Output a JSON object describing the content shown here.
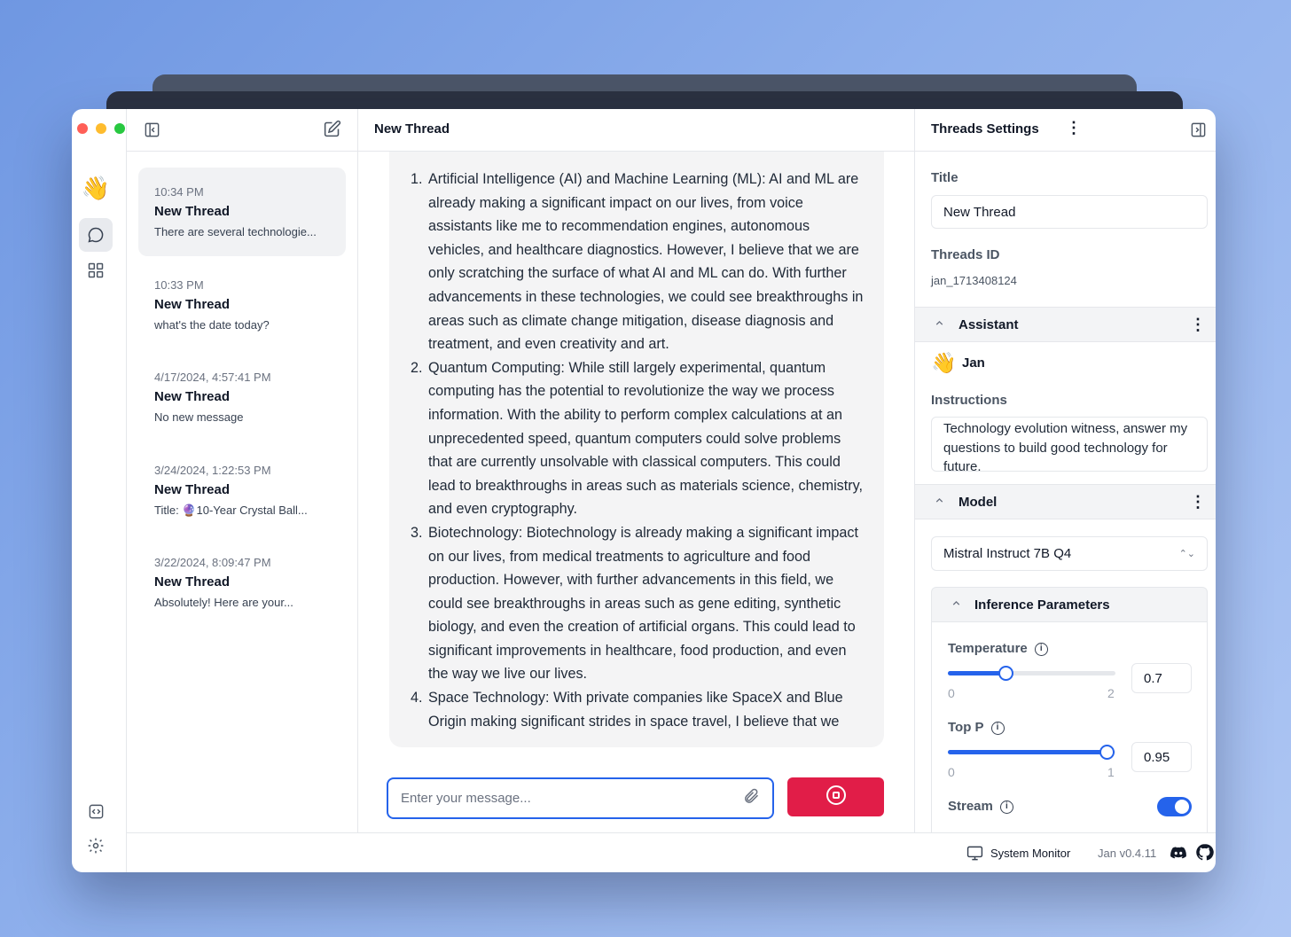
{
  "colors": {
    "accent": "#2563eb",
    "stop": "#e11d48"
  },
  "header": {
    "title": "New Thread"
  },
  "threads": [
    {
      "time": "10:34 PM",
      "title": "New Thread",
      "snippet": "There are several technologie..."
    },
    {
      "time": "10:33 PM",
      "title": "New Thread",
      "snippet": "what's the date today?"
    },
    {
      "time": "4/17/2024, 4:57:41 PM",
      "title": "New Thread",
      "snippet": "No new message"
    },
    {
      "time": "3/24/2024, 1:22:53 PM",
      "title": "New Thread",
      "snippet": "Title: 🔮10-Year Crystal Ball..."
    },
    {
      "time": "3/22/2024, 8:09:47 PM",
      "title": "New Thread",
      "snippet": "Absolutely! Here are your..."
    }
  ],
  "message": {
    "items": [
      {
        "num": "1.",
        "text": "Artificial Intelligence (AI) and Machine Learning (ML): AI and ML are already making a significant impact on our lives, from voice assistants like me to recommendation engines, autonomous vehicles, and healthcare diagnostics. However, I believe that we are only scratching the surface of what AI and ML can do. With further advancements in these technologies, we could see breakthroughs in areas such as climate change mitigation, disease diagnosis and treatment, and even creativity and art."
      },
      {
        "num": "2.",
        "text": "Quantum Computing: While still largely experimental, quantum computing has the potential to revolutionize the way we process information. With the ability to perform complex calculations at an unprecedented speed, quantum computers could solve problems that are currently unsolvable with classical computers. This could lead to breakthroughs in areas such as materials science, chemistry, and even cryptography."
      },
      {
        "num": "3.",
        "text": "Biotechnology: Biotechnology is already making a significant impact on our lives, from medical treatments to agriculture and food production. However, with further advancements in this field, we could see breakthroughs in areas such as gene editing, synthetic biology, and even the creation of artificial organs. This could lead to significant improvements in healthcare, food production, and even the way we live our lives."
      },
      {
        "num": "4.",
        "text": "Space Technology: With private companies like SpaceX and Blue Origin making significant strides in space travel, I believe that we"
      }
    ]
  },
  "composer": {
    "placeholder": "Enter your message..."
  },
  "settings": {
    "heading": "Threads Settings",
    "title_label": "Title",
    "title_value": "New Thread",
    "id_label": "Threads ID",
    "id_value": "jan_1713408124",
    "assistant_label": "Assistant",
    "assistant_name": "Jan",
    "instructions_label": "Instructions",
    "instructions_value": "Technology evolution witness, answer my questions to build good technology for future.",
    "model_label": "Model",
    "model_value": "Mistral Instruct 7B Q4",
    "inference_label": "Inference Parameters",
    "temperature": {
      "label": "Temperature",
      "value": "0.7",
      "min": "0",
      "max": "2",
      "fraction": 0.35
    },
    "top_p": {
      "label": "Top P",
      "value": "0.95",
      "min": "0",
      "max": "1",
      "fraction": 0.95
    },
    "stream_label": "Stream",
    "stream_on": true
  },
  "footer": {
    "system_monitor": "System Monitor",
    "version": "Jan v0.4.11"
  },
  "icons": [
    "wave-emoji",
    "chat-icon",
    "grid-icon",
    "code-icon",
    "gear-icon",
    "collapse-left-icon",
    "edit-icon",
    "collapse-right-icon",
    "paperclip-icon",
    "stop-icon",
    "monitor-icon",
    "discord-icon",
    "github-icon"
  ]
}
